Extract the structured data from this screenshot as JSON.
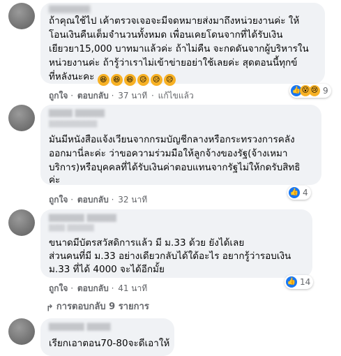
{
  "comments": [
    {
      "lines": [
        "ถ้าคุณใช้ไป  เค้าตรวจเจอจะมีจดหมายส่งมาถึงหน่วยงานค่ะ  ให้",
        "โอนเงินคืนเต็มจำนวนทั้งหมด  เพื่อนเคยโดนจากที่ได้รับเงิน",
        "เยียวยา15,000  บาทมาแล้วค่ะ  ถ้าไม่คืน  จะกดดันจากผู้บริหารใน",
        "หน่วยงานค่ะ  ถ้ารู้ว่าเราไม่เข้าข่ายอย่าใช้เลยค่ะ  สุดตอนนี้ทุกข์",
        "ที่หลังนะคะ"
      ],
      "emoji_tail": [
        "grin",
        "grin",
        "grin",
        "sad",
        "sad",
        "sad"
      ],
      "actions": {
        "like": "ถูกใจ",
        "reply": "ตอบกลับ",
        "time": "37 นาที",
        "edited": "แก้ไขแล้ว"
      },
      "reactions": {
        "icons": [
          "like",
          "wow",
          "sad"
        ],
        "count": "9"
      }
    },
    {
      "name_blur": "▇▇▇▇ ▇▇▇▇▇",
      "sub_blur": "▇▇▇▇▇▇▇▇▇",
      "lines": [
        "มันมีหนังสือแจ้งเวียนจากกรมบัญชีกลางหรือกระทรวงการคลัง",
        "ออกมานี่ละค่ะ  ว่าขอความร่วมมือให้ลูกจ้างของรัฐ(จ้างเหมา",
        "บริการ)หรือบุคคลที่ได้รับเงินค่าตอบแทนจากรัฐไม่ให้กดรับสิทธิ",
        "ค่ะ"
      ],
      "actions": {
        "like": "ถูกใจ",
        "reply": "ตอบกลับ",
        "time": "32 นาที"
      },
      "reactions": {
        "icons": [
          "like"
        ],
        "count": "4"
      }
    },
    {
      "name_blur": "▇▇▇▇▇▇ ▇▇▇▇▇",
      "sub_blur": "▇▇▇ ▇▇▇▇▇",
      "lines": [
        "ขนาดมีบัตรสวัสดิการแล้ว  มี  ม.33  ด้วย  ยังได้เลย",
        "ส่วนคนที่มี  ม.33  อย่างเดียวกลับได้ใด้อะไร  อยากรู้ว่ารอบเงิน",
        "ม.33  ที่ได้  4000  จะได้อีกมั้ย"
      ],
      "actions": {
        "like": "ถูกใจ",
        "reply": "ตอบกลับ",
        "time": "41 นาที"
      },
      "reactions": {
        "icons": [
          "like"
        ],
        "count": "14"
      }
    },
    {
      "name_blur": "▇▇▇▇▇▇ ▇▇▇▇",
      "lines": [
        "เรียกเอาตอน70-80จะดีเอาให้"
      ]
    }
  ],
  "replies_label": "การตอบกลับ 9 รายการ",
  "colors": {
    "bubble": "#f0f2f5",
    "like": "#1877f2",
    "meta": "#65676b"
  }
}
